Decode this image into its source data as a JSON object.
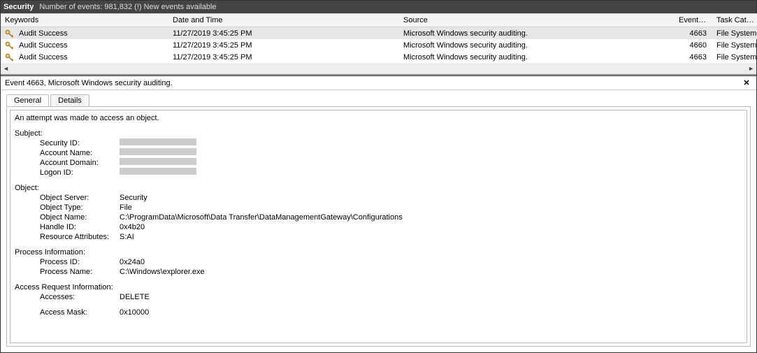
{
  "titlebar": {
    "primary": "Security",
    "secondary": "Number of events: 981,832 (!) New events available"
  },
  "columns": {
    "keywords": "Keywords",
    "datetime": "Date and Time",
    "source": "Source",
    "eventid": "Event ID",
    "taskcat": "Task Category"
  },
  "updown": {
    "up": "▲",
    "down": "▼"
  },
  "rows": [
    {
      "keywords": "Audit Success",
      "datetime": "11/27/2019 3:45:25 PM",
      "source": "Microsoft Windows security auditing.",
      "eventid": "4663",
      "taskcat": "File System",
      "selected": true
    },
    {
      "keywords": "Audit Success",
      "datetime": "11/27/2019 3:45:25 PM",
      "source": "Microsoft Windows security auditing.",
      "eventid": "4660",
      "taskcat": "File System",
      "selected": false
    },
    {
      "keywords": "Audit Success",
      "datetime": "11/27/2019 3:45:25 PM",
      "source": "Microsoft Windows security auditing.",
      "eventid": "4663",
      "taskcat": "File System",
      "selected": false
    }
  ],
  "hscroll": {
    "left": "◄",
    "right": "►"
  },
  "detail": {
    "title": "Event 4663, Microsoft Windows security auditing.",
    "close": "✕",
    "tabs": {
      "general": "General",
      "details": "Details"
    },
    "summary": "An attempt was made to access an object.",
    "subject": {
      "head": "Subject:",
      "security_id_label": "Security ID:",
      "account_name_label": "Account Name:",
      "account_domain_label": "Account Domain:",
      "logon_id_label": "Logon ID:"
    },
    "object": {
      "head": "Object:",
      "server_label": "Object Server:",
      "server": "Security",
      "type_label": "Object Type:",
      "type": "File",
      "name_label": "Object Name:",
      "name": "C:\\ProgramData\\Microsoft\\Data Transfer\\DataManagementGateway\\Configurations",
      "handle_label": "Handle ID:",
      "handle": "0x4b20",
      "resattr_label": "Resource Attributes:",
      "resattr": "S:AI"
    },
    "process": {
      "head": "Process Information:",
      "pid_label": "Process ID:",
      "pid": "0x24a0",
      "pname_label": "Process Name:",
      "pname": "C:\\Windows\\explorer.exe"
    },
    "access": {
      "head": "Access Request Information:",
      "accesses_label": "Accesses:",
      "accesses": "DELETE",
      "mask_label": "Access Mask:",
      "mask": "0x10000"
    }
  }
}
